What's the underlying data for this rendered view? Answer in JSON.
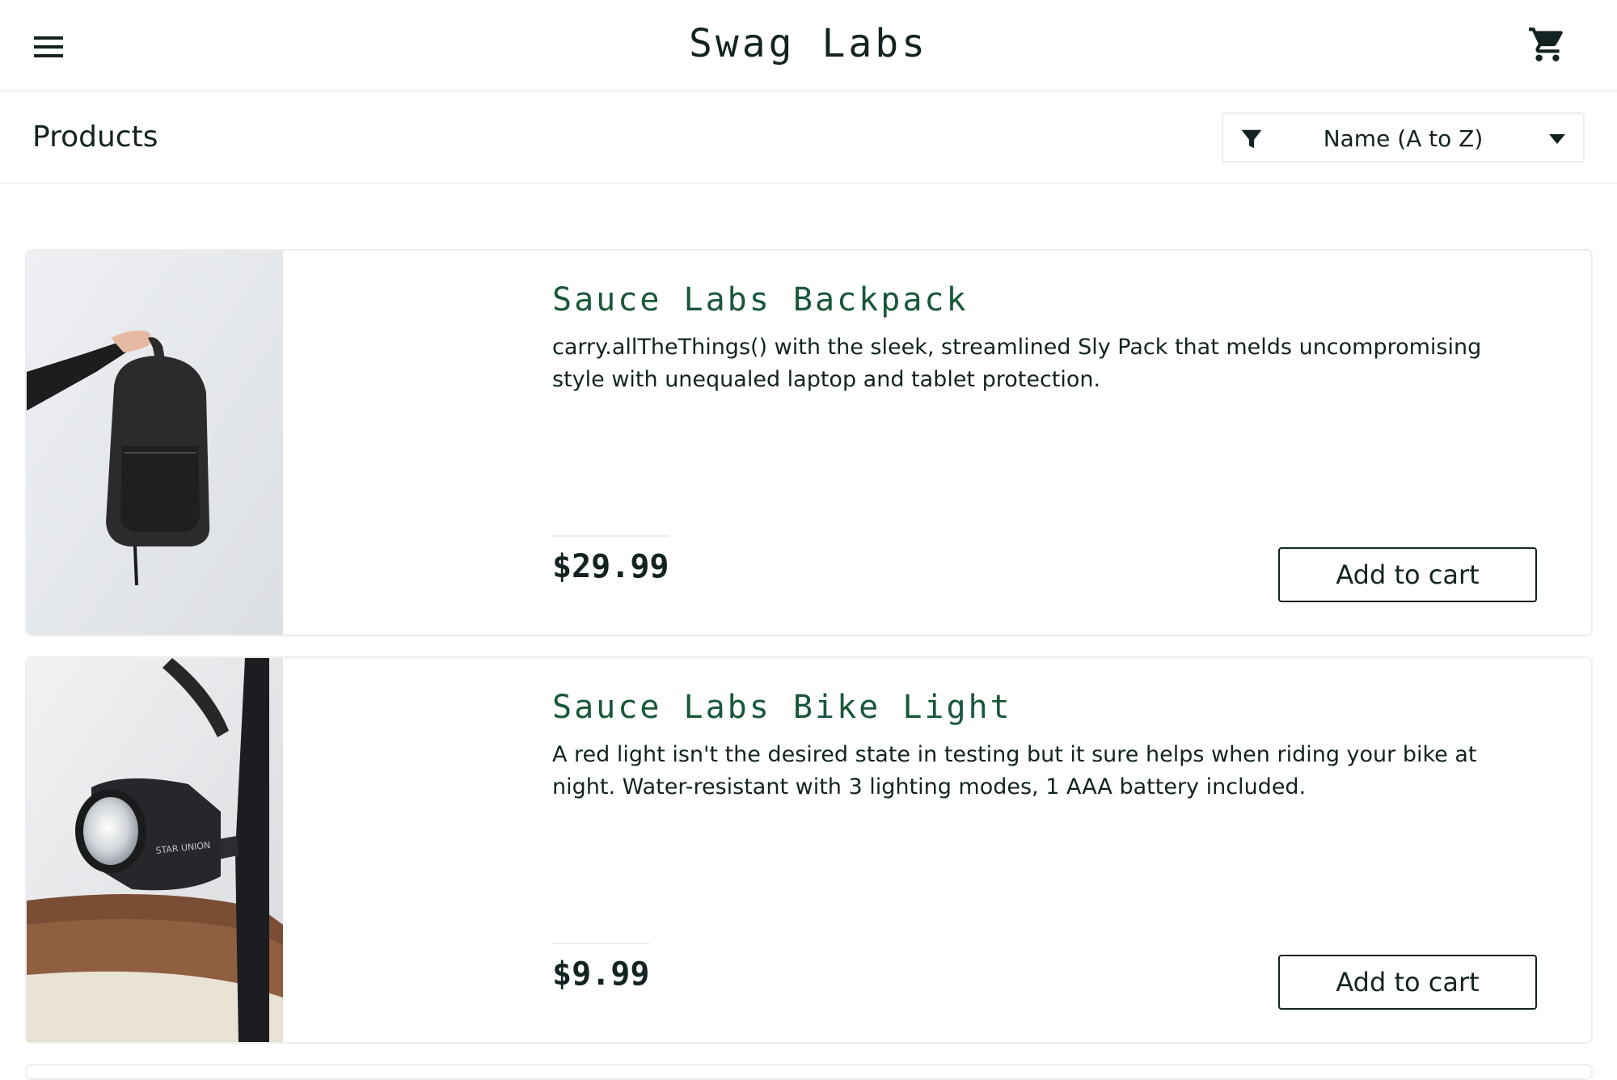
{
  "header": {
    "app_title": "Swag Labs",
    "menu_icon": "hamburger-menu-icon",
    "cart_icon": "shopping-cart-icon"
  },
  "sub_header": {
    "title": "Products",
    "sort": {
      "icon": "filter-funnel-icon",
      "selected": "Name (A to Z)",
      "caret_icon": "caret-down-icon"
    }
  },
  "inventory": {
    "items": [
      {
        "name": "Sauce Labs Backpack",
        "description": "carry.allTheThings() with the sleek, streamlined Sly Pack that melds uncompromising style with unequaled laptop and tablet protection.",
        "price": "$29.99",
        "button_label": "Add to cart",
        "image_icon": "backpack-photo"
      },
      {
        "name": "Sauce Labs Bike Light",
        "description": "A red light isn't the desired state in testing but it sure helps when riding your bike at night. Water-resistant with 3 lighting modes, 1 AAA battery included.",
        "price": "$9.99",
        "button_label": "Add to cart",
        "image_icon": "bike-light-photo"
      }
    ]
  },
  "colors": {
    "item_name": "#18583a",
    "text": "#132322",
    "border": "#ededed"
  }
}
